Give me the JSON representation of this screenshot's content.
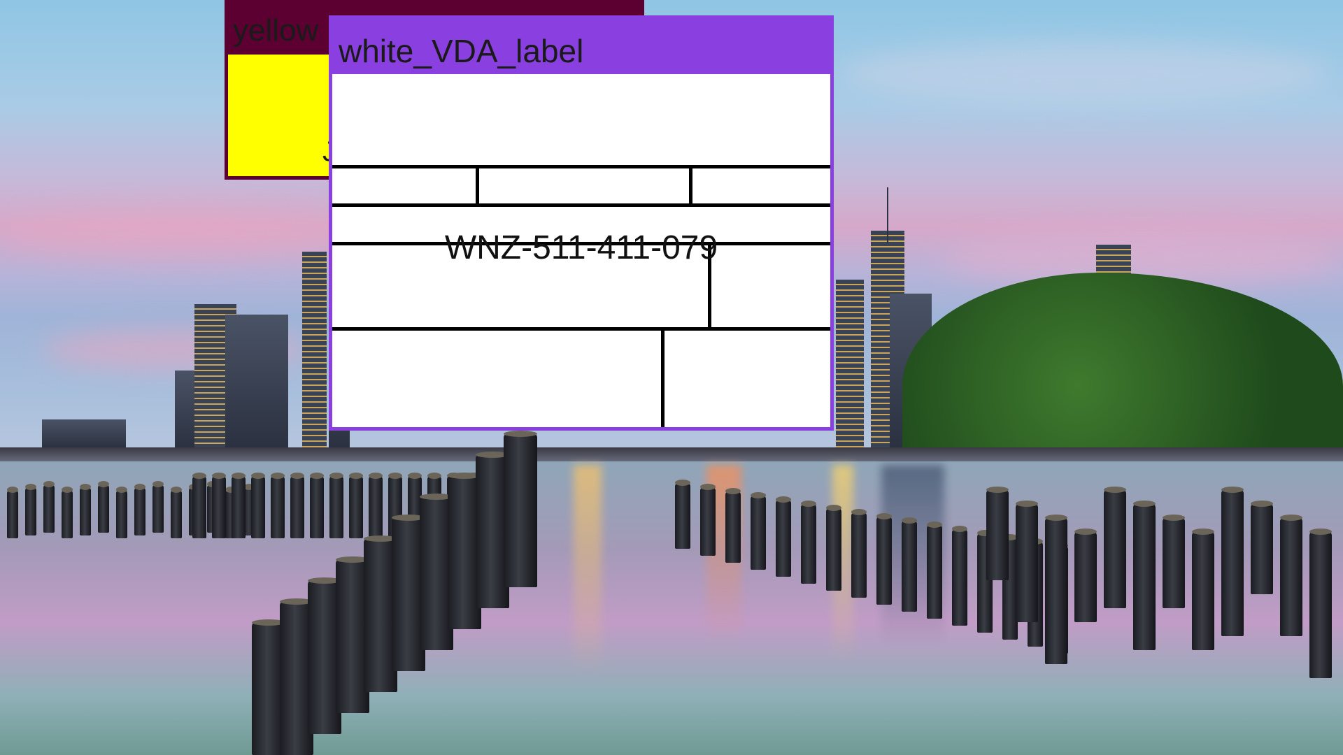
{
  "windows": {
    "yellow": {
      "title": "yellow",
      "titlebar_color": "#5b0030",
      "body_color": "#ffff00",
      "body_glyph": "J"
    },
    "white_label": {
      "title": "white_VDA_label",
      "titlebar_color": "#8a3fe0",
      "body_color": "#ffffff",
      "label_id": "WNZ-511-411-079"
    }
  },
  "wallpaper": {
    "subject": "city-skyline-with-pier-pilings"
  }
}
